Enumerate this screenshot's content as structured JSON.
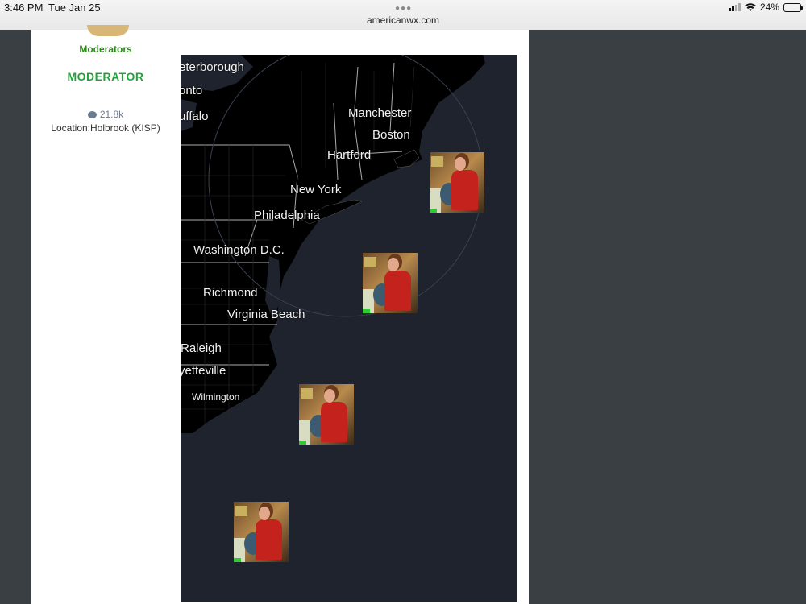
{
  "status_bar": {
    "time": "3:46 PM",
    "date": "Tue Jan 25",
    "url": "americanwx.com",
    "battery": "24%",
    "battery_level": 0.24,
    "icons": [
      "signal-icon",
      "wifi-icon",
      "battery-icon"
    ]
  },
  "profile": {
    "group": "Moderators",
    "rank": "MODERATOR",
    "post_count": "21.8k",
    "location_label": "Location:",
    "location_value": "Holbrook (KISP)"
  },
  "map": {
    "cities": [
      "eterborough",
      "onto",
      "uffalo",
      "Manchester",
      "Boston",
      "Hartford",
      "New York",
      "Philadelphia",
      "Washington D.C.",
      "Richmond",
      "Virginia Beach",
      "Raleigh",
      "yetteville",
      "Wilmington"
    ],
    "marker_count": 4
  },
  "colors": {
    "group": "#2c8a1a",
    "rank": "#22a33a",
    "map_ocean": "#1e232e",
    "map_land": "#000000",
    "page_bg": "#3a3f44"
  }
}
